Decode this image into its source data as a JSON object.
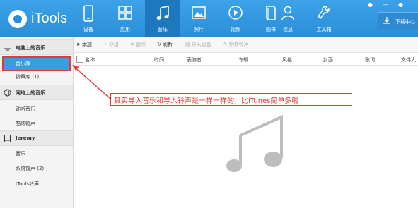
{
  "app": {
    "name": "iTools"
  },
  "nav": [
    {
      "key": "device",
      "label": "设备"
    },
    {
      "key": "apps",
      "label": "应用"
    },
    {
      "key": "music",
      "label": "音乐",
      "active": true
    },
    {
      "key": "photos",
      "label": "照片"
    },
    {
      "key": "video",
      "label": "视频"
    },
    {
      "key": "books",
      "label": "图书"
    },
    {
      "key": "info",
      "label": "信息"
    },
    {
      "key": "tools",
      "label": "工具箱"
    }
  ],
  "download": {
    "label": "下载中心"
  },
  "sidebar": {
    "sections": [
      {
        "title": "电脑上的音乐",
        "items": [
          "音乐库",
          "铃声库 (1)"
        ]
      },
      {
        "title": "网络上的音乐",
        "items": [
          "动听音乐",
          "酷炫铃声"
        ]
      },
      {
        "title": "Jeremy",
        "items": [
          "音乐",
          "系统铃声 (2)",
          "iTools铃声"
        ]
      }
    ]
  },
  "toolbar": {
    "add": "添加",
    "export": "导出",
    "delete": "删除",
    "refresh": "刷新",
    "import_device": "导入设备",
    "make_ringtone": "制作铃声"
  },
  "columns": [
    "名称",
    "时间",
    "表演者",
    "专辑",
    "风格",
    "封面",
    "歌词",
    "文件大"
  ],
  "annotation": {
    "text": "其实导入音乐和导入铃声是一样一样的，比iTunes简单多啦",
    "color": "#e03a3a"
  },
  "colors": {
    "accent": "#2a8fd8",
    "active_nav": "#1d78bd",
    "selection": "#3c9be5",
    "annotation": "#e03a3a"
  }
}
